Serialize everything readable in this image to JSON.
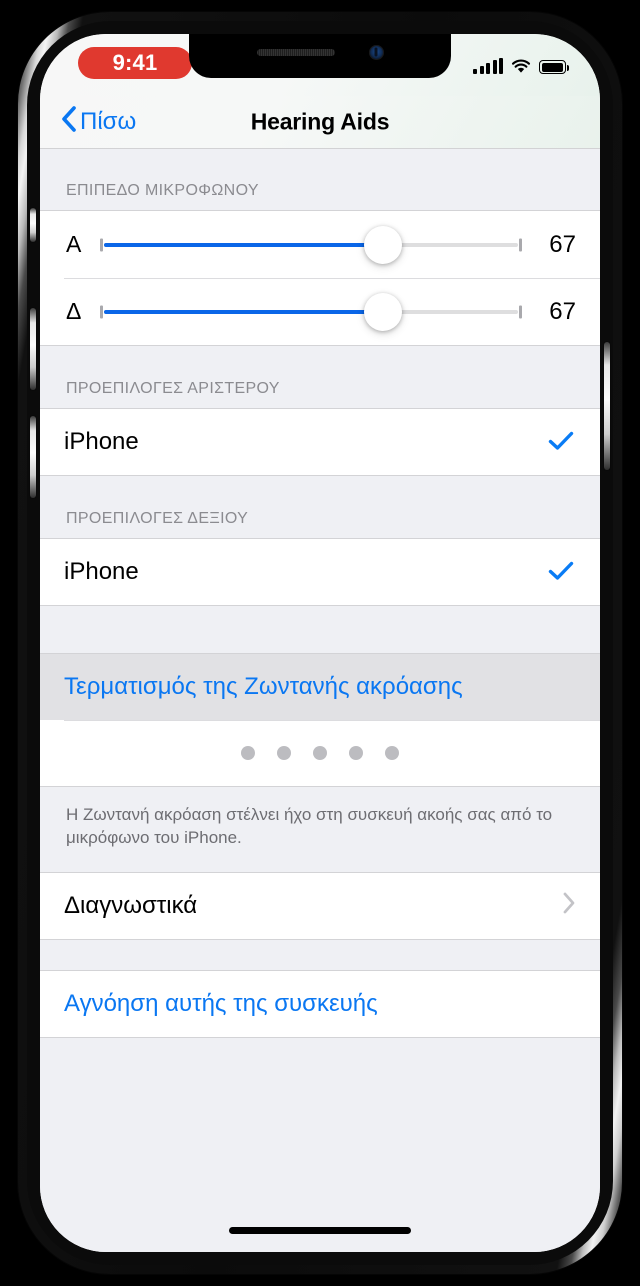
{
  "statusbar": {
    "time": "9:41",
    "signal_icon": "cellular-bars-icon",
    "wifi_icon": "wifi-icon",
    "battery_icon": "battery-full-icon"
  },
  "navbar": {
    "back_label": "Πίσω",
    "back_icon": "chevron-left-icon",
    "title": "Hearing Aids"
  },
  "sections": {
    "mic_level": {
      "header": "ΕΠΙΠΕΔΟ ΜΙΚΡΟΦΩΝΟΥ",
      "sliders": [
        {
          "side_label": "Α",
          "value": "67",
          "percent": 67
        },
        {
          "side_label": "Δ",
          "value": "67",
          "percent": 67
        }
      ]
    },
    "left_presets": {
      "header": "ΠΡΟΕΠΙΛΟΓΕΣ ΑΡΙΣΤΕΡΟΥ",
      "item_label": "iPhone",
      "checked_icon": "checkmark-icon"
    },
    "right_presets": {
      "header": "ΠΡΟΕΠΙΛΟΓΕΣ ΔΕΞΙΟΥ",
      "item_label": "iPhone",
      "checked_icon": "checkmark-icon"
    },
    "live_listen": {
      "action_label": "Τερματισμός της Ζωντανής ακρόασης",
      "level_dots": 5,
      "footnote": "Η Ζωντανή ακρόαση στέλνει ήχο στη συσκευή ακοής σας από το μικρόφωνο του iPhone."
    },
    "diagnostics": {
      "label": "Διαγνωστικά",
      "chevron_icon": "chevron-right-icon"
    },
    "forget": {
      "label": "Αγνόηση αυτής της συσκευής"
    }
  },
  "colors": {
    "accent_blue": "#0a77f2",
    "record_red": "#e0392f",
    "slider_blue": "#0a66e8",
    "group_bg": "#eff0f4",
    "dot_gray": "#bcbcc0"
  }
}
